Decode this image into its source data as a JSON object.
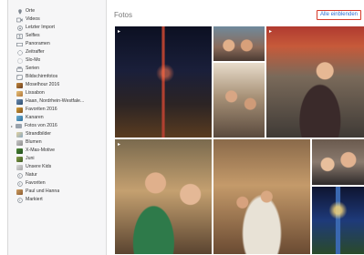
{
  "main": {
    "title": "Fotos",
    "show_all_label": "Alle einblenden"
  },
  "sidebar": {
    "items": [
      {
        "label": "Orte",
        "icon": "pin-icon"
      },
      {
        "label": "Videos",
        "icon": "video-icon"
      },
      {
        "label": "Letzter Import",
        "icon": "import-icon"
      },
      {
        "label": "Selfies",
        "icon": "selfie-icon"
      },
      {
        "label": "Panoramen",
        "icon": "panorama-icon"
      },
      {
        "label": "Zeitraffer",
        "icon": "timelapse-icon"
      },
      {
        "label": "Slo-Mo",
        "icon": "slomo-icon"
      },
      {
        "label": "Serien",
        "icon": "burst-icon"
      },
      {
        "label": "Bildschirmfotos",
        "icon": "screenshot-icon"
      },
      {
        "label": "Moselhour 2016",
        "icon": "album-thumbnail-icon"
      },
      {
        "label": "Lissabon",
        "icon": "album-thumbnail-icon"
      },
      {
        "label": "Haan, Nordrhein-Westfale...",
        "icon": "album-thumbnail-icon"
      },
      {
        "label": "Favoriten 2016",
        "icon": "album-thumbnail-icon"
      },
      {
        "label": "Kanaren",
        "icon": "album-thumbnail-icon"
      },
      {
        "label": "Fotos von 2016",
        "icon": "folder-icon"
      },
      {
        "label": "Strandbilder",
        "icon": "album-thumbnail-icon"
      },
      {
        "label": "Blumen",
        "icon": "album-thumbnail-icon"
      },
      {
        "label": "X-Mas-Motive",
        "icon": "album-thumbnail-icon"
      },
      {
        "label": "Juni",
        "icon": "album-thumbnail-icon"
      },
      {
        "label": "Unsere Kids",
        "icon": "album-thumbnail-icon"
      },
      {
        "label": "Natur",
        "icon": "smart-album-icon"
      },
      {
        "label": "Favoriten",
        "icon": "smart-album-icon"
      },
      {
        "label": "Paul und Hanna",
        "icon": "album-thumbnail-icon"
      },
      {
        "label": "Markiert",
        "icon": "smart-album-icon"
      }
    ]
  },
  "colors": {
    "link": "#2a6fd6",
    "highlight_border": "#d63a2a",
    "sidebar_bg": "#f6f6f7"
  }
}
